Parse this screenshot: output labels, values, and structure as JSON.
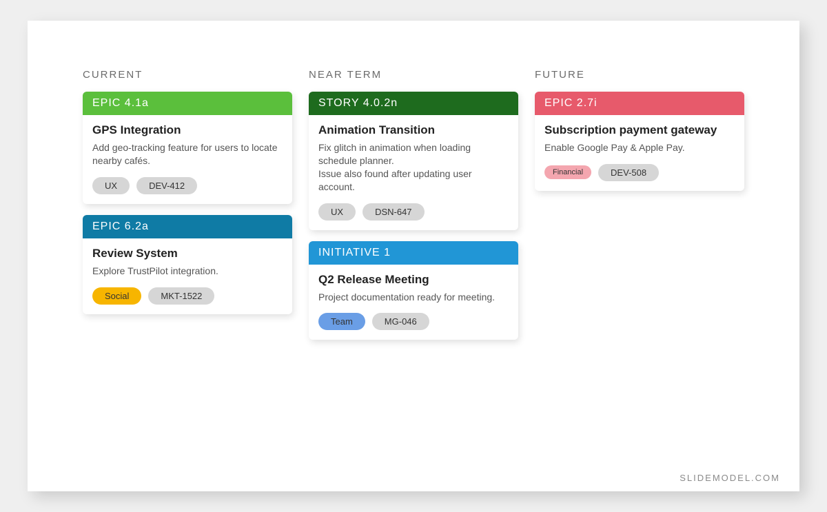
{
  "watermark": "SLIDEMODEL.COM",
  "colors": {
    "green_light": "#5bbf3c",
    "green_dark": "#1e6b1e",
    "teal": "#0f7ba5",
    "blue": "#2196d6",
    "red": "#e75a6b",
    "grey_pill": "#d6d6d6",
    "yellow_pill": "#f7b500",
    "blue_pill": "#6a9ee6",
    "pink_pill": "#f4a6af"
  },
  "columns": [
    {
      "header": "CURRENT",
      "cards": [
        {
          "header_label": "EPIC 4.1a",
          "header_color": "green_light",
          "title": "GPS Integration",
          "desc": "Add geo-tracking feature for users to locate nearby cafés.",
          "tags": [
            {
              "label": "UX",
              "color": "grey_pill"
            },
            {
              "label": "DEV-412",
              "color": "grey_pill"
            }
          ]
        },
        {
          "header_label": "EPIC 6.2a",
          "header_color": "teal",
          "title": "Review System",
          "desc": "Explore TrustPilot integration.",
          "tags": [
            {
              "label": "Social",
              "color": "yellow_pill"
            },
            {
              "label": "MKT-1522",
              "color": "grey_pill"
            }
          ]
        }
      ]
    },
    {
      "header": "NEAR TERM",
      "cards": [
        {
          "header_label": "STORY 4.0.2n",
          "header_color": "green_dark",
          "title": "Animation Transition",
          "desc": "Fix glitch in animation when loading schedule planner.\nIssue also found after updating user account.",
          "tags": [
            {
              "label": "UX",
              "color": "grey_pill"
            },
            {
              "label": "DSN-647",
              "color": "grey_pill"
            }
          ]
        },
        {
          "header_label": "INITIATIVE  1",
          "header_color": "blue",
          "title": "Q2 Release Meeting",
          "desc": "Project documentation ready for meeting.",
          "tags": [
            {
              "label": "Team",
              "color": "blue_pill"
            },
            {
              "label": "MG-046",
              "color": "grey_pill"
            }
          ]
        }
      ]
    },
    {
      "header": "FUTURE",
      "cards": [
        {
          "header_label": "EPIC 2.7i",
          "header_color": "red",
          "title": "Subscription payment gateway",
          "desc": "Enable Google Pay & Apple Pay.",
          "tags": [
            {
              "label": "Financial",
              "color": "pink_pill",
              "small": true
            },
            {
              "label": "DEV-508",
              "color": "grey_pill"
            }
          ]
        }
      ]
    }
  ]
}
